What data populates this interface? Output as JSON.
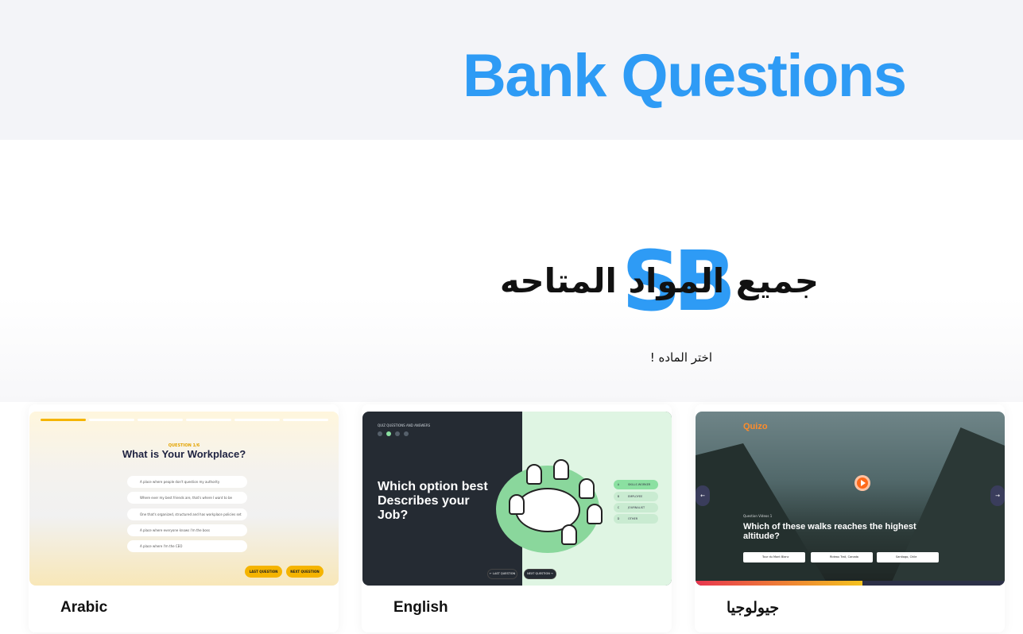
{
  "hero": {
    "title": "Bank Questions"
  },
  "section": {
    "logo_text": "SB",
    "title": "جميع المواد المتاحه",
    "subtitle": "اختر الماده !"
  },
  "colors": {
    "accent": "#2e9bf5",
    "hero_bg": "#f3f4f8"
  },
  "cards": [
    {
      "label": "Arabic",
      "thumb": {
        "question_number": "QUESTION 1/6",
        "title": "What is Your Workplace?",
        "options": [
          "A place where people don't question my authority",
          "Where ever my best friends are, that's where I want to be",
          "One that's organized, structured and has workplace policies set",
          "A place where everyone knows I'm the boss",
          "A place where I'm the CEO"
        ],
        "last_button": "LAST QUESTION",
        "next_button": "NEXT QUESTION"
      }
    },
    {
      "label": "English",
      "thumb": {
        "kicker": "QUIZ QUESTIONS AND ANSWERS",
        "title": "Which option best Describes your Job?",
        "answers": [
          {
            "letter": "A",
            "text": "SKILLS WORKER"
          },
          {
            "letter": "B",
            "text": "EMPLOYEE"
          },
          {
            "letter": "C",
            "text": "JOURNALIST"
          },
          {
            "letter": "D",
            "text": "OTHER"
          }
        ],
        "last_button": "← LAST QUESTION",
        "next_button": "NEXT QUESTION →"
      }
    },
    {
      "label": "جيولوجيا",
      "thumb": {
        "brand": "Quizo",
        "sub": "Question Videos 1",
        "question": "Which of these walks reaches the highest altitude?",
        "choices": [
          "Tour du Mont Blanc",
          "Rideau Trail, Canada",
          "Santiago, Chile"
        ],
        "progress": 0.54,
        "prev_arrow": "←",
        "next_arrow": "→"
      }
    }
  ]
}
